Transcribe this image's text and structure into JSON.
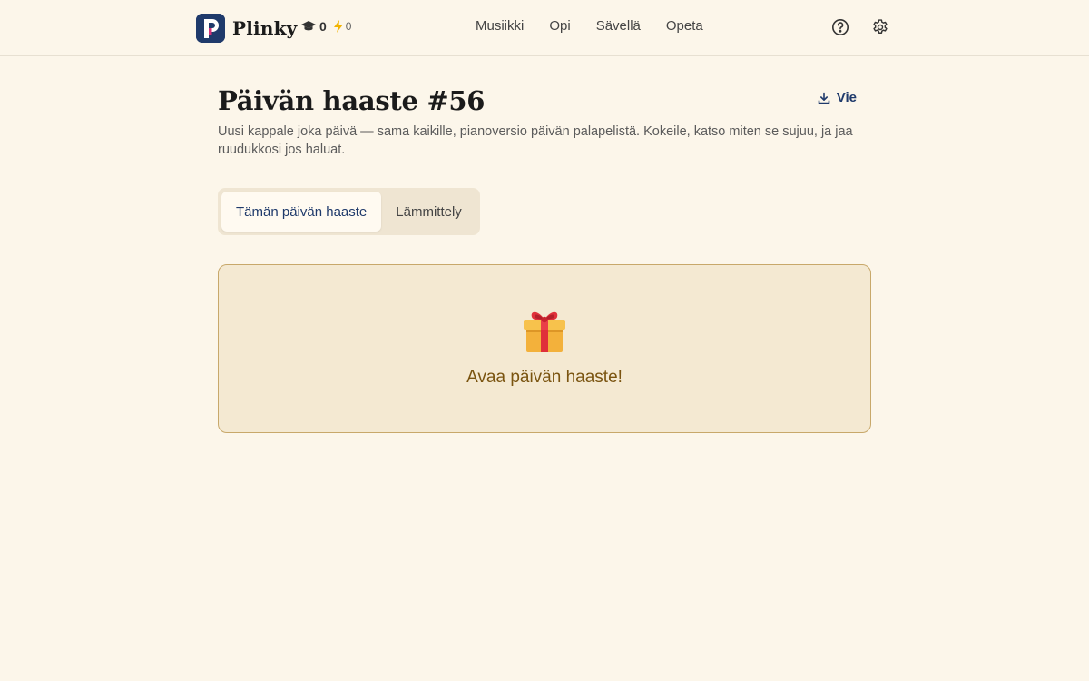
{
  "app": {
    "brand_name": "Plinky",
    "logo_letter": "P"
  },
  "stats": {
    "xp_icon": "graduation-cap-icon",
    "xp_value": "0",
    "streak_icon": "lightning-icon",
    "streak_value": "0"
  },
  "nav": {
    "items": [
      {
        "label": "Musiikki"
      },
      {
        "label": "Opi"
      },
      {
        "label": "Sävellä"
      },
      {
        "label": "Opeta"
      }
    ]
  },
  "header_actions": {
    "help_icon": "question-circle-icon",
    "settings_icon": "gear-icon"
  },
  "page": {
    "title": "Päivän haaste #56",
    "export_label": "Vie",
    "export_icon": "download-icon",
    "subtitle": "Uusi kappale joka päivä — sama kaikille, pianoversio päivän palapelistä. Kokeile, katso miten se sujuu, ja jaa ruudukkosi jos haluat."
  },
  "tabs": {
    "items": [
      {
        "label": "Tämän päivän haaste",
        "active": true
      },
      {
        "label": "Lämmittely",
        "active": false
      }
    ]
  },
  "challenge_card": {
    "icon": "gift-icon",
    "label": "Avaa päivän haaste!"
  },
  "colors": {
    "background": "#fcf6ea",
    "brand": "#1f3a6b",
    "logo_accent": "#d6337a",
    "card_bg": "#f4e9d2",
    "card_border": "#c8a86a",
    "card_text": "#7a5410"
  }
}
